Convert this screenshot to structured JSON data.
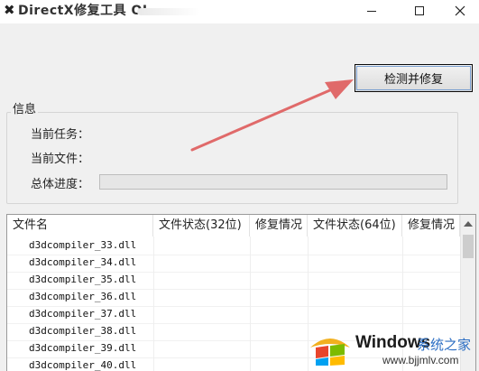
{
  "window": {
    "title": "DirectX修复工具 OL",
    "icon": "directx-icon",
    "controls": [
      "minimize-icon",
      "maximize-icon",
      "close-icon"
    ]
  },
  "actions": {
    "repair_label": "检测并修复"
  },
  "info": {
    "group_title": "信息",
    "current_task_label": "当前任务：",
    "current_file_label": "当前文件：",
    "total_progress_label": "总体进度：",
    "progress": 0
  },
  "table": {
    "columns": [
      "文件名",
      "文件状态(32位)",
      "修复情况",
      "文件状态(64位)",
      "修复情况"
    ],
    "rows": [
      "d3dcompiler_33.dll",
      "d3dcompiler_34.dll",
      "d3dcompiler_35.dll",
      "d3dcompiler_36.dll",
      "d3dcompiler_37.dll",
      "d3dcompiler_38.dll",
      "d3dcompiler_39.dll",
      "d3dcompiler_40.dll"
    ]
  },
  "watermark": {
    "brand": "Windows",
    "site_name": "系统之家",
    "url": "www.bjjmlv.com"
  },
  "colors": {
    "arrow": "#e06a6a",
    "button_focus": "#7a9fd0",
    "watermark_blue": "#2d6fc4"
  }
}
